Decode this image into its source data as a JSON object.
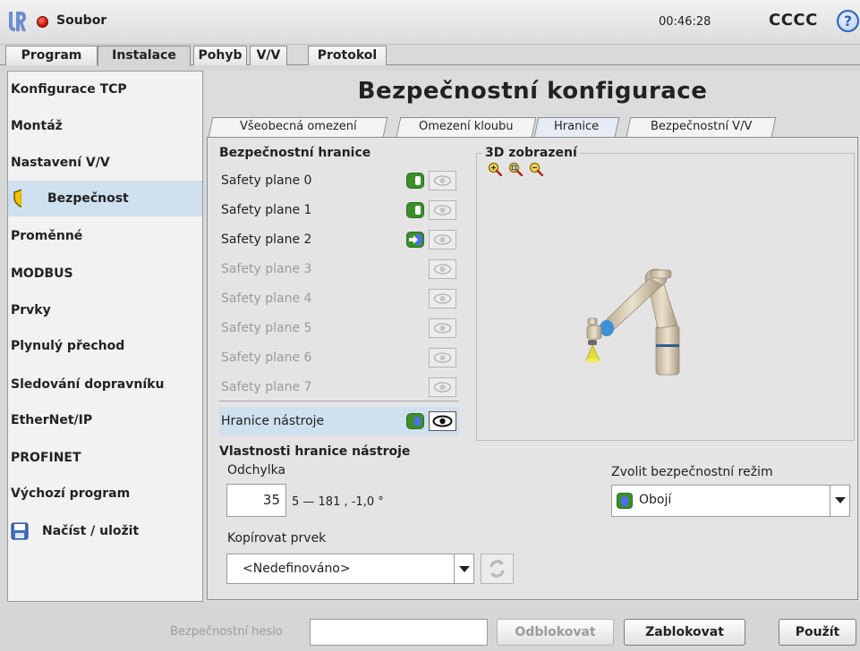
{
  "titlebar": {
    "file_label": "Soubor",
    "clock": "00:46:28",
    "robot_name": "CCCC",
    "help": "?"
  },
  "top_tabs": [
    "Program",
    "Instalace",
    "Pohyb",
    "V/V",
    "Protokol"
  ],
  "sidebar": {
    "items": [
      {
        "label": "Konfigurace TCP"
      },
      {
        "label": "Montáž"
      },
      {
        "label": "Nastavení V/V"
      },
      {
        "label": "Bezpečnost"
      },
      {
        "label": "Proměnné"
      },
      {
        "label": "MODBUS"
      },
      {
        "label": "Prvky"
      },
      {
        "label": "Plynulý přechod"
      },
      {
        "label": "Sledování dopravníku"
      },
      {
        "label": "EtherNet/IP"
      },
      {
        "label": "PROFINET"
      },
      {
        "label": "Výchozí program"
      },
      {
        "label": "Načíst / uložit"
      }
    ]
  },
  "main": {
    "title": "Bezpečnostní konfigurace",
    "sub_tabs": [
      "Všeobecná omezení",
      "Omezení kloubu",
      "Hranice",
      "Bezpečnostní V/V"
    ],
    "boundaries_title": "Bezpečnostní hranice",
    "planes": [
      {
        "label": "Safety plane 0"
      },
      {
        "label": "Safety plane 1"
      },
      {
        "label": "Safety plane 2"
      },
      {
        "label": "Safety plane 3"
      },
      {
        "label": "Safety plane 4"
      },
      {
        "label": "Safety plane 5"
      },
      {
        "label": "Safety plane 6"
      },
      {
        "label": "Safety plane 7"
      },
      {
        "label": "Hranice nástroje"
      }
    ],
    "view3d_title": "3D zobrazení",
    "tool_props_title": "Vlastnosti hranice nástroje",
    "deviation_label": "Odchylka",
    "deviation_value": "35",
    "deviation_range": "5 — 181 , -1,0 °",
    "safety_mode_label": "Zvolit bezpečnostní režim",
    "safety_mode_value": "Obojí",
    "copy_label": "Kopírovat prvek",
    "copy_value": "<Nedefinováno>"
  },
  "footer": {
    "password_label": "Bezpečnostní heslo",
    "password_value": "",
    "unlock": "Odblokovat",
    "lock": "Zablokovat",
    "apply": "Použít"
  },
  "colors": {
    "accent_blue": "#cfe0ef",
    "toggle_green": "#3a8f2c",
    "warning_yellow": "#f2c200"
  }
}
